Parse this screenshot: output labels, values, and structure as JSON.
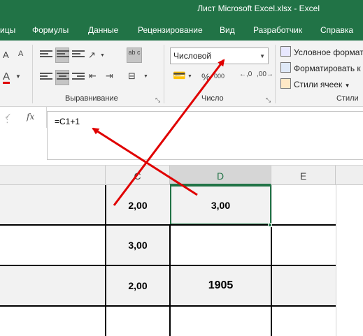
{
  "window": {
    "title": "Лист Microsoft Excel.xlsx  -  Excel"
  },
  "tabs": [
    "ицы",
    "Формулы",
    "Данные",
    "Рецензирование",
    "Вид",
    "Разработчик",
    "Справка"
  ],
  "ribbon": {
    "font_size_up": "A",
    "font_size_down": "A",
    "font_color": "A",
    "wrap_text": "ab c",
    "alignment_label": "Выравнивание",
    "number_label": "Число",
    "styles_label": "Стили",
    "number_format": "Числовой",
    "percent": "%",
    "thousands": "000",
    "conditional_formatting": "Условное формат",
    "format_as_table": "Форматировать к",
    "cell_styles": "Стили ячеек"
  },
  "formula_bar": {
    "confirm_symbol": "✓",
    "fx": "fx",
    "formula": "=C1+1"
  },
  "columns": {
    "c": "C",
    "d": "D",
    "e": "E"
  },
  "cells": {
    "c1": "2,00",
    "d1": "3,00",
    "c2": "3,00",
    "d2": "",
    "c3": "2,00",
    "d3": "1905"
  },
  "colors": {
    "ribbon_green": "#217346",
    "annotation_red": "#e00000",
    "selection_green": "#217346"
  }
}
